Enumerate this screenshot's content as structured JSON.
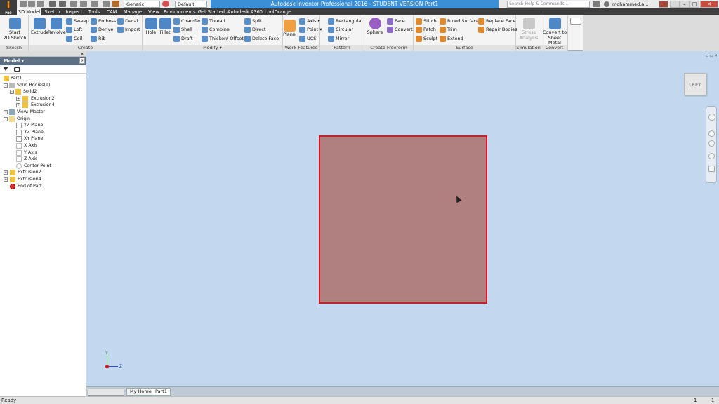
{
  "app": {
    "button_label": "I",
    "pro_label": "PRO"
  },
  "toolbar": {
    "material": "Generic",
    "appearance": "Default"
  },
  "window": {
    "title": "Autodesk Inventor Professional 2016 - STUDENT VERSION    Part1",
    "min": "–",
    "max": "□",
    "close": "✕"
  },
  "search": {
    "placeholder": "Search Help & Commands..."
  },
  "user": {
    "name": "mohammed.a..."
  },
  "tabs": [
    "3D Model",
    "Sketch",
    "Inspect",
    "Tools",
    "CAM",
    "Manage",
    "View",
    "Environments",
    "Get Started",
    "Autodesk A360",
    "coolOrange"
  ],
  "ribbon": {
    "sketch": {
      "label": "Sketch",
      "start": "Start",
      "start2": "2D Sketch"
    },
    "create": {
      "label": "Create",
      "extrude": "Extrude",
      "revolve": "Revolve",
      "sweep": "Sweep",
      "loft": "Loft",
      "coil": "Coil",
      "emboss": "Emboss",
      "derive": "Derive",
      "rib": "Rib",
      "decal": "Decal",
      "import": "Import"
    },
    "modify": {
      "label": "Modify ▾",
      "hole": "Hole",
      "fillet": "Fillet",
      "chamfer": "Chamfer",
      "shell": "Shell",
      "draft": "Draft",
      "thread": "Thread",
      "combine": "Combine",
      "thicken": "Thicken/ Offset",
      "split": "Split",
      "direct": "Direct",
      "delete_face": "Delete Face"
    },
    "work": {
      "label": "Work Features",
      "plane": "Plane",
      "axis": "Axis ▾",
      "point": "Point ▾",
      "ucs": "UCS"
    },
    "pattern": {
      "label": "Pattern",
      "rect": "Rectangular",
      "circ": "Circular",
      "mirror": "Mirror"
    },
    "freeform": {
      "label": "Create Freeform",
      "sphere": "Sphere",
      "face": "Face",
      "convert": "Convert"
    },
    "surface": {
      "label": "Surface",
      "stitch": "Stitch",
      "patch": "Patch",
      "sculpt": "Sculpt",
      "ruled": "Ruled Surface",
      "trim": "Trim",
      "extend": "Extend",
      "replace": "Replace Face",
      "repair": "Repair Bodies"
    },
    "simulation": {
      "label": "Simulation",
      "stress": "Stress",
      "stress2": "Analysis"
    },
    "convert": {
      "label": "Convert",
      "c1": "Convert to",
      "c2": "Sheet Metal"
    }
  },
  "model_panel": {
    "title": "Model ▾",
    "close": "×",
    "help": "?",
    "tree": [
      {
        "label": "Part1",
        "expand": ""
      },
      {
        "label": "Solid Bodies(1)",
        "expand": "-"
      },
      {
        "label": "Solid2",
        "expand": "-"
      },
      {
        "label": "Extrusion2",
        "expand": "+"
      },
      {
        "label": "Extrusion4",
        "expand": "+"
      },
      {
        "label": "View: Master",
        "expand": "+"
      },
      {
        "label": "Origin",
        "expand": "-"
      },
      {
        "label": "YZ Plane",
        "expand": ""
      },
      {
        "label": "XZ Plane",
        "expand": ""
      },
      {
        "label": "XY Plane",
        "expand": ""
      },
      {
        "label": "X Axis",
        "expand": ""
      },
      {
        "label": "Y Axis",
        "expand": ""
      },
      {
        "label": "Z Axis",
        "expand": ""
      },
      {
        "label": "Center Point",
        "expand": ""
      },
      {
        "label": "Extrusion2",
        "expand": "+"
      },
      {
        "label": "Extrusion4",
        "expand": "+"
      },
      {
        "label": "End of Part",
        "expand": ""
      }
    ]
  },
  "viewcube": {
    "face": "LEFT"
  },
  "triad": {
    "y": "Y",
    "z": "Z"
  },
  "doc_tabs": {
    "home": "My Home",
    "part": "Part1"
  },
  "status": {
    "text": "Ready",
    "count1": "1",
    "count2": "1"
  }
}
